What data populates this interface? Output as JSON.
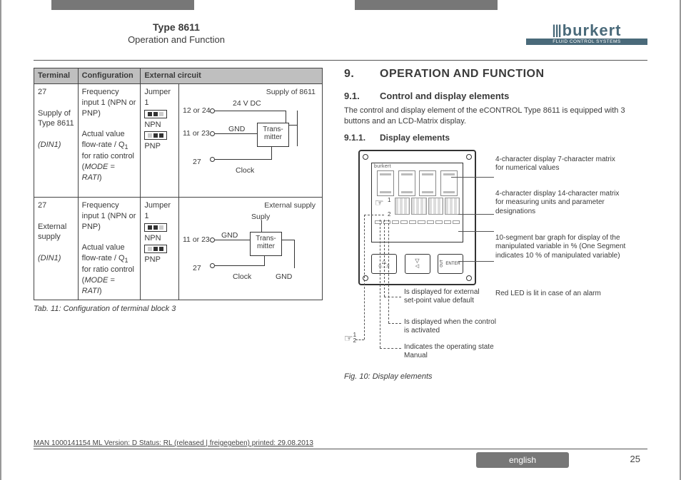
{
  "header": {
    "type_title": "Type 8611",
    "type_sub": "Operation and Function",
    "logo_text": "burkert",
    "logo_tag": "FLUID CONTROL SYSTEMS"
  },
  "table": {
    "h1": "Terminal",
    "h2": "Configuration",
    "h3": "External circuit",
    "row1": {
      "terminal_line1": "27",
      "terminal_line2": "Supply of Type 8611",
      "terminal_line3": "(DIN1)",
      "config_line1": "Frequency input 1 (NPN or PNP)",
      "config_line2": "Actual value flow-rate / Q",
      "config_line2b": " for ratio control (",
      "config_line2c": "MODE = RATI",
      "config_line2d": ")",
      "jumper": "Jumper 1",
      "npn": "NPN",
      "pnp": "PNP",
      "circ_title": "Supply of 8611",
      "v24": "24 V DC",
      "t1224": "12 or 24",
      "t1123": "11 or 23",
      "t27": "27",
      "gnd": "GND",
      "clock": "Clock",
      "trans": "Trans-mitter"
    },
    "row2": {
      "terminal_line1": "27",
      "terminal_line2": "External supply",
      "terminal_line3": "(DIN1)",
      "config_line1": "Frequency input 1 (NPN or PNP)",
      "config_line2": "Actual value flow-rate / Q",
      "config_line2b": " for ratio control (",
      "config_line2c": "MODE = RATI",
      "config_line2d": ")",
      "jumper": "Jumper 1",
      "npn": "NPN",
      "pnp": "PNP",
      "circ_title": "External supply",
      "supply": "Suply",
      "t1123": "11 or 23",
      "t27": "27",
      "gnd1": "GND",
      "gnd2": "GND",
      "clock": "Clock",
      "trans": "Trans-mitter"
    },
    "caption": "Tab. 11:  Configuration of terminal block 3"
  },
  "right": {
    "h_num": "9.",
    "h_txt": "OPERATION AND FUNCTION",
    "h1_num": "9.1.",
    "h1_txt": "Control and display elements",
    "para": "The control and display element of the eCONTROL Type 8611 is equipped with 3 buttons and an LCD-Matrix display.",
    "h2_num": "9.1.1.",
    "h2_txt": "Display elements",
    "device_brand": "burkert",
    "btn1_a": "△",
    "btn1_b": "0.....9",
    "btn2_a": "▽",
    "btn2_b": "◁",
    "btn3_a": "ENTER",
    "btn3_o": "OUT",
    "callout1": "4-character display 7-character matrix for numerical values",
    "callout2": "4-character display 14-character matrix for measuring units and parameter designations",
    "callout3": "10-segment bar graph for display of the manipulated variable in % (One Segment indicates 10 % of manipulated variable)",
    "callout4": "Red LED is lit in case of an alarm",
    "callout5": "Is displayed for external set-point value default",
    "callout6": "Is displayed when the control is activated",
    "callout7": "Indicates the operating state Manual",
    "fig_caption": "Fig. 10:   Display elements"
  },
  "footer": {
    "meta": "MAN  1000141154  ML  Version: D Status: RL (released | freigegeben)  printed: 29.08.2013",
    "lang": "english",
    "page": "25"
  }
}
